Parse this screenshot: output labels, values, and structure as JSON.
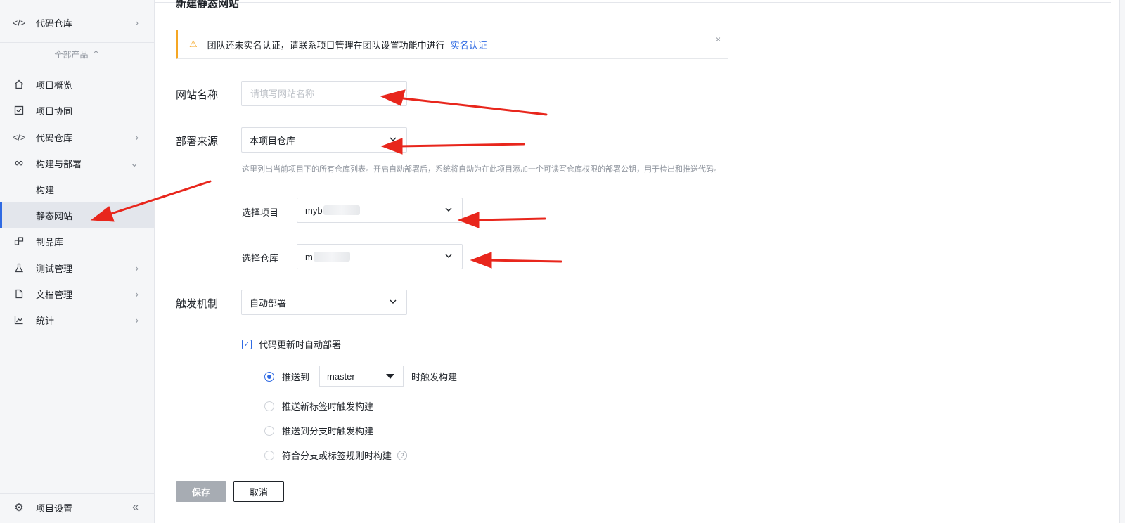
{
  "sidebar": {
    "top_item": {
      "label": "代码仓库"
    },
    "all_products": "全部产品",
    "items": [
      {
        "label": "项目概览",
        "icon": "home-icon"
      },
      {
        "label": "项目协同",
        "icon": "checkbox-icon"
      },
      {
        "label": "代码仓库",
        "icon": "code-icon"
      },
      {
        "label": "构建与部署",
        "icon": "infinity-icon"
      },
      {
        "label": "构建"
      },
      {
        "label": "静态网站",
        "active": true
      },
      {
        "label": "制品库",
        "icon": "package-icon"
      },
      {
        "label": "测试管理",
        "icon": "flask-icon"
      },
      {
        "label": "文档管理",
        "icon": "document-icon"
      },
      {
        "label": "统计",
        "icon": "chart-icon"
      }
    ],
    "settings": {
      "label": "项目设置"
    }
  },
  "page": {
    "title": "新建静态网站",
    "alert": {
      "text": "团队还未实名认证，请联系项目管理在团队设置功能中进行",
      "link": "实名认证",
      "close": "×"
    }
  },
  "form": {
    "site_name": {
      "label": "网站名称",
      "placeholder": "请填写网站名称",
      "value": ""
    },
    "source": {
      "label": "部署来源",
      "value": "本项目仓库"
    },
    "hint": "这里列出当前项目下的所有仓库列表。开启自动部署后，系统将自动为在此项目添加一个可读写仓库权限的部署公钥，用于检出和推送代码。",
    "project": {
      "label": "选择项目",
      "value": "myb"
    },
    "repo": {
      "label": "选择仓库",
      "value": "m"
    },
    "trigger": {
      "label": "触发机制",
      "value": "自动部署"
    },
    "auto_deploy": {
      "label": "代码更新时自动部署",
      "checked": true
    },
    "radios": {
      "push_to": "推送到",
      "branch": "master",
      "push_to_suffix": "时触发构建",
      "new_tag": "推送新标签时触发构建",
      "push_branch": "推送到分支时触发构建",
      "rule": "符合分支或标签规则时构建"
    },
    "save": "保存",
    "cancel": "取消"
  },
  "colors": {
    "accent": "#2f6ae3",
    "warning": "#f5a623",
    "annotation_arrow": "#e8261c"
  }
}
